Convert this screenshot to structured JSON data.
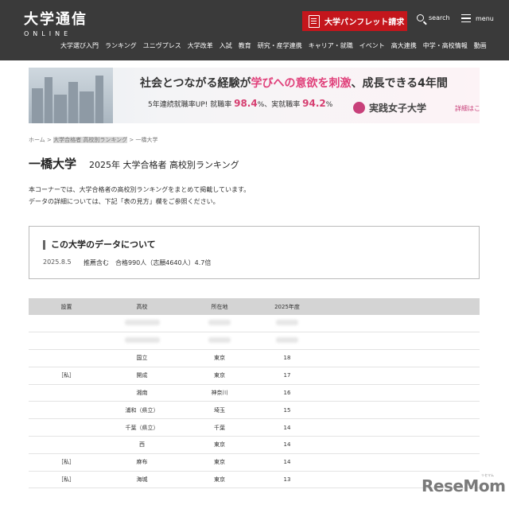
{
  "header": {
    "logo_main": "大学通信",
    "logo_sub": "ONLINE",
    "pamphlet_label": "大学パンフレット請求",
    "search_label": "search",
    "menu_label": "menu",
    "nav": [
      "大学選び入門",
      "ランキング",
      "ユニヴプレス",
      "大学改革",
      "入試",
      "教育",
      "研究・産学連携",
      "キャリア・就職",
      "イベント",
      "高大連携",
      "中学・高校情報",
      "動画"
    ]
  },
  "banner": {
    "headline_pre": "社会とつながる経験が",
    "headline_em": "学びへの意欲を刺激",
    "headline_post": "、成長できる4年間",
    "stats_pre": "5年連続就職率UP!  就職率",
    "stats_value1": "98.4",
    "stats_mid": "%、実就職率",
    "stats_value2": "94.2",
    "stats_post": "%",
    "university": "実践女子大学",
    "cta": "詳細はこちら"
  },
  "breadcrumb": {
    "home": "ホーム",
    "ranking": "大学合格者 高校別ランキング",
    "current": "一橋大学",
    "separator": ">"
  },
  "page": {
    "university": "一橋大学",
    "ranking_title": "2025年 大学合格者 高校別ランキング",
    "intro_line1": "本コーナーでは、大学合格者の高校別ランキングをまとめて掲載しています。",
    "intro_line2": "データの詳細については、下記「表の見方」欄をご参照ください。"
  },
  "databox": {
    "title": "この大学のデータについて",
    "date": "2025.8.5",
    "detail": "推薦含む　合格990人（志願4640人）4.7倍"
  },
  "table": {
    "headers": [
      "設置",
      "高校",
      "所在地",
      "2025年度"
    ],
    "rows": [
      {
        "type": "",
        "school": "国立",
        "location": "東京",
        "count": "18"
      },
      {
        "type": "［私］",
        "school": "開成",
        "location": "東京",
        "count": "17"
      },
      {
        "type": "",
        "school": "湘南",
        "location": "神奈川",
        "count": "16"
      },
      {
        "type": "",
        "school": "浦和（県立）",
        "location": "埼玉",
        "count": "15"
      },
      {
        "type": "",
        "school": "千葉（県立）",
        "location": "千葉",
        "count": "14"
      },
      {
        "type": "",
        "school": "西",
        "location": "東京",
        "count": "14"
      },
      {
        "type": "［私］",
        "school": "麻布",
        "location": "東京",
        "count": "14"
      },
      {
        "type": "［私］",
        "school": "海城",
        "location": "東京",
        "count": "13"
      }
    ]
  },
  "watermark": {
    "brand": "ReseMom",
    "ruby": "リセマム"
  }
}
